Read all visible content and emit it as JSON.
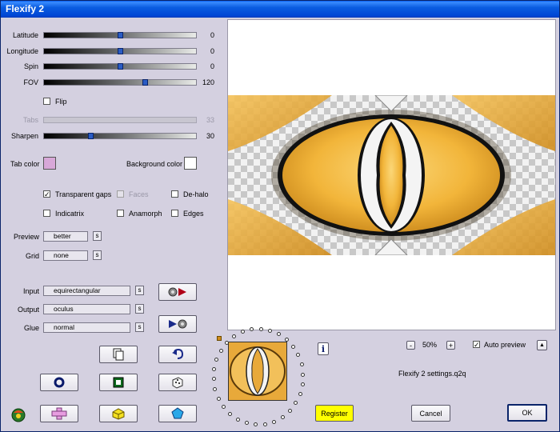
{
  "window": {
    "title": "Flexify 2"
  },
  "sliders": [
    {
      "label": "Latitude",
      "value": "0",
      "level_pct": 50
    },
    {
      "label": "Longitude",
      "value": "0",
      "level_pct": 50
    },
    {
      "label": "Spin",
      "value": "0",
      "level_pct": 50
    },
    {
      "label": "FOV",
      "value": "120",
      "level_pct": 67
    }
  ],
  "flip": {
    "label": "Flip",
    "checked": false
  },
  "tabs": {
    "label": "Tabs",
    "value": "33"
  },
  "sharpen": {
    "label": "Sharpen",
    "value": "30",
    "level_pct": 30
  },
  "colors": {
    "tab_label": "Tab color",
    "tab_color": "#d8a8d8",
    "background_label": "Background color",
    "background_color": "#ffffff"
  },
  "checks": {
    "transparent_gaps": {
      "label": "Transparent gaps",
      "checked": true
    },
    "faces": {
      "label": "Faces",
      "checked": false
    },
    "de_halo": {
      "label": "De-halo",
      "checked": false
    },
    "indicatrix": {
      "label": "Indicatrix",
      "checked": false
    },
    "anamorph": {
      "label": "Anamorph",
      "checked": false
    },
    "edges": {
      "label": "Edges",
      "checked": false
    }
  },
  "preview_quality": {
    "label": "Preview",
    "value": "better",
    "button": "s"
  },
  "grid": {
    "label": "Grid",
    "value": "none",
    "button": "s"
  },
  "input": {
    "label": "Input",
    "value": "equirectangular",
    "button": "s"
  },
  "output": {
    "label": "Output",
    "value": "oculus",
    "button": "s"
  },
  "glue": {
    "label": "Glue",
    "value": "normal",
    "button": "s"
  },
  "zoom": {
    "minus": "-",
    "value": "50%",
    "plus": "+"
  },
  "auto_preview": {
    "label": "Auto preview",
    "checked": true,
    "arrow": "▲"
  },
  "info_button": "i",
  "settings_file": "Flexify 2 settings.q2q",
  "buttons": {
    "register": "Register",
    "cancel": "Cancel",
    "ok": "OK"
  },
  "accent": {
    "register_bg": "#ffff00",
    "preview_gold": "#f2b53a"
  }
}
